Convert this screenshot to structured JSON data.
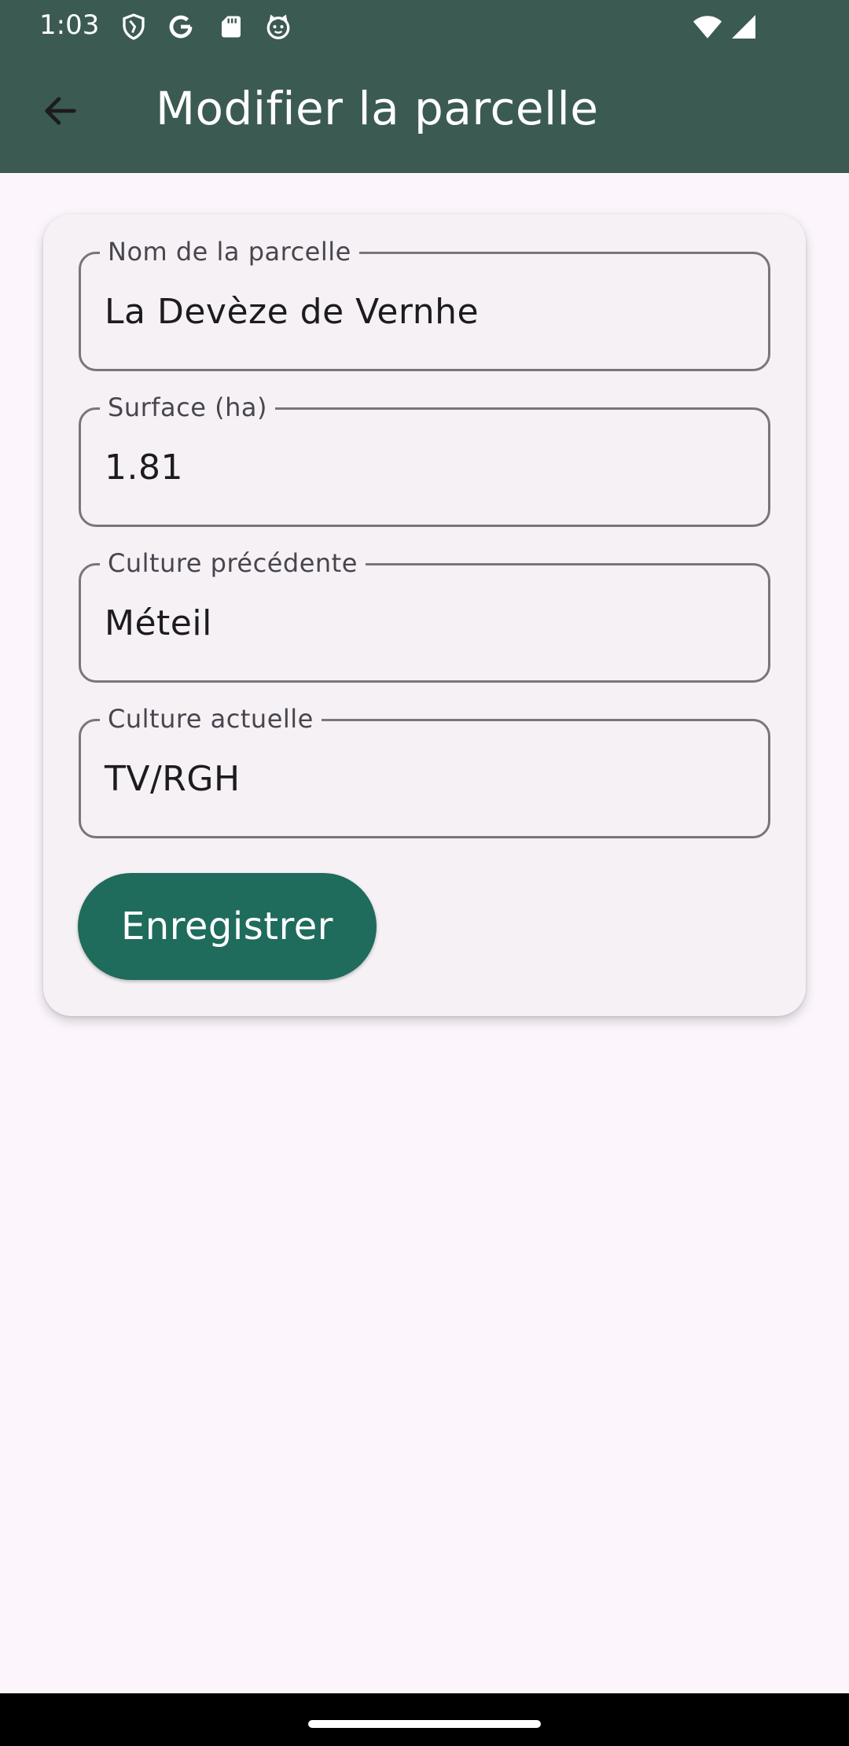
{
  "status_bar": {
    "time": "1:03",
    "icons": [
      "shield-icon",
      "google-icon",
      "sd-card-icon",
      "cat-face-icon",
      "wifi-icon",
      "signal-icon"
    ]
  },
  "app_bar": {
    "title": "Modifier la parcelle",
    "back_icon": "arrow-back-icon"
  },
  "form": {
    "fields": [
      {
        "label": "Nom de la parcelle",
        "value": "La Devèze de Vernhe"
      },
      {
        "label": "Surface (ha)",
        "value": "1.81"
      },
      {
        "label": "Culture précédente",
        "value": "Méteil"
      },
      {
        "label": "Culture actuelle",
        "value": "TV/RGH"
      }
    ],
    "save_label": "Enregistrer"
  },
  "colors": {
    "app_bar": "#3b5a52",
    "primary_button": "#1f6b5c",
    "background": "#fcf6fc",
    "card": "#f5f1f5"
  }
}
